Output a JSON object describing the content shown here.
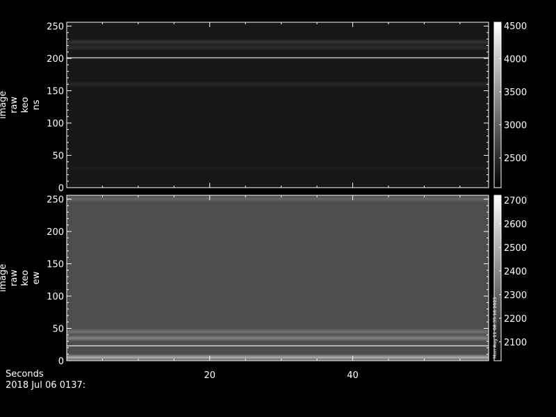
{
  "chart_data": [
    {
      "type": "heatmap",
      "ylabel_lines": [
        "image",
        "raw",
        "keo",
        "ns"
      ],
      "xlim": [
        0,
        59
      ],
      "ylim": [
        0,
        256
      ],
      "x_ticks": [
        20,
        40
      ],
      "y_ticks": [
        0,
        50,
        100,
        150,
        200,
        250
      ],
      "colorbar": {
        "min": 2050,
        "max": 4550,
        "ticks": [
          2500,
          3000,
          3500,
          4000,
          4500
        ]
      },
      "base_value": 2280,
      "bands": [
        {
          "y": 201,
          "value": 4400
        },
        {
          "y": 225,
          "value": 2550
        },
        {
          "y": 217,
          "value": 2500
        },
        {
          "y": 160,
          "value": 2450
        },
        {
          "y": 30,
          "value": 2330
        }
      ]
    },
    {
      "type": "heatmap",
      "ylabel_lines": [
        "image",
        "raw",
        "keo",
        "ew"
      ],
      "xlim": [
        0,
        59
      ],
      "ylim": [
        0,
        256
      ],
      "x_ticks": [
        20,
        40
      ],
      "y_ticks": [
        0,
        50,
        100,
        150,
        200,
        250
      ],
      "colorbar": {
        "min": 2020,
        "max": 2720,
        "ticks": [
          2100,
          2200,
          2300,
          2400,
          2500,
          2600,
          2700
        ]
      },
      "colorbar_annotation": "Mon Aug 11 08:35:16 2025",
      "base_value": 2230,
      "bands": [
        {
          "y": 23,
          "value": 2700
        },
        {
          "y": 5,
          "value": 2500
        },
        {
          "y": 35,
          "value": 2380
        },
        {
          "y": 45,
          "value": 2330
        },
        {
          "y": 250,
          "value": 2300
        }
      ]
    }
  ],
  "footer": {
    "xlabel": "Seconds",
    "date": "2018 Jul 06 0137:"
  }
}
